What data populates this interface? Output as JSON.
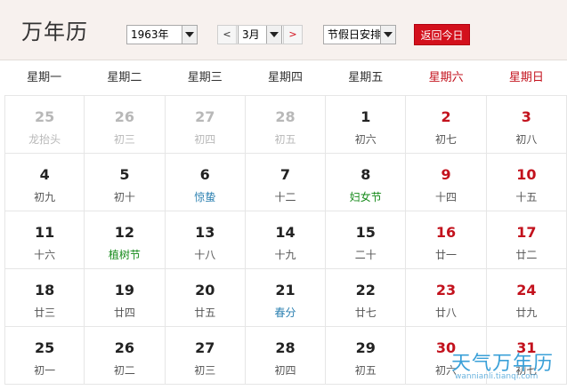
{
  "header": {
    "title": "万年历",
    "year_value": "1963年",
    "prev_label": "<",
    "month_value": "3月",
    "next_label": ">",
    "holiday_value": "节假日安排",
    "today_label": "返回今日"
  },
  "weekdays": [
    "星期一",
    "星期二",
    "星期三",
    "星期四",
    "星期五",
    "星期六",
    "星期日"
  ],
  "weeks": [
    [
      {
        "day": "25",
        "lunar": "龙抬头",
        "other": true
      },
      {
        "day": "26",
        "lunar": "初三",
        "other": true
      },
      {
        "day": "27",
        "lunar": "初四",
        "other": true
      },
      {
        "day": "28",
        "lunar": "初五",
        "other": true
      },
      {
        "day": "1",
        "lunar": "初六"
      },
      {
        "day": "2",
        "lunar": "初七"
      },
      {
        "day": "3",
        "lunar": "初八"
      }
    ],
    [
      {
        "day": "4",
        "lunar": "初九"
      },
      {
        "day": "5",
        "lunar": "初十"
      },
      {
        "day": "6",
        "lunar": "惊蛰",
        "kind": "term"
      },
      {
        "day": "7",
        "lunar": "十二"
      },
      {
        "day": "8",
        "lunar": "妇女节",
        "kind": "fest"
      },
      {
        "day": "9",
        "lunar": "十四"
      },
      {
        "day": "10",
        "lunar": "十五"
      }
    ],
    [
      {
        "day": "11",
        "lunar": "十六"
      },
      {
        "day": "12",
        "lunar": "植树节",
        "kind": "fest"
      },
      {
        "day": "13",
        "lunar": "十八"
      },
      {
        "day": "14",
        "lunar": "十九"
      },
      {
        "day": "15",
        "lunar": "二十"
      },
      {
        "day": "16",
        "lunar": "廿一"
      },
      {
        "day": "17",
        "lunar": "廿二"
      }
    ],
    [
      {
        "day": "18",
        "lunar": "廿三"
      },
      {
        "day": "19",
        "lunar": "廿四"
      },
      {
        "day": "20",
        "lunar": "廿五"
      },
      {
        "day": "21",
        "lunar": "春分",
        "kind": "term"
      },
      {
        "day": "22",
        "lunar": "廿七"
      },
      {
        "day": "23",
        "lunar": "廿八"
      },
      {
        "day": "24",
        "lunar": "廿九"
      }
    ],
    [
      {
        "day": "25",
        "lunar": "初一"
      },
      {
        "day": "26",
        "lunar": "初二"
      },
      {
        "day": "27",
        "lunar": "初三"
      },
      {
        "day": "28",
        "lunar": "初四"
      },
      {
        "day": "29",
        "lunar": "初五"
      },
      {
        "day": "30",
        "lunar": "初六"
      },
      {
        "day": "31",
        "lunar": "初七"
      }
    ]
  ],
  "watermark": {
    "text": "天气万年历",
    "url": "wannianli.tianqi.com"
  },
  "colors": {
    "accent_red": "#d3101c",
    "header_bg": "#f7f1ee",
    "solar_term": "#2a7fb0",
    "festival": "#158a1a"
  }
}
